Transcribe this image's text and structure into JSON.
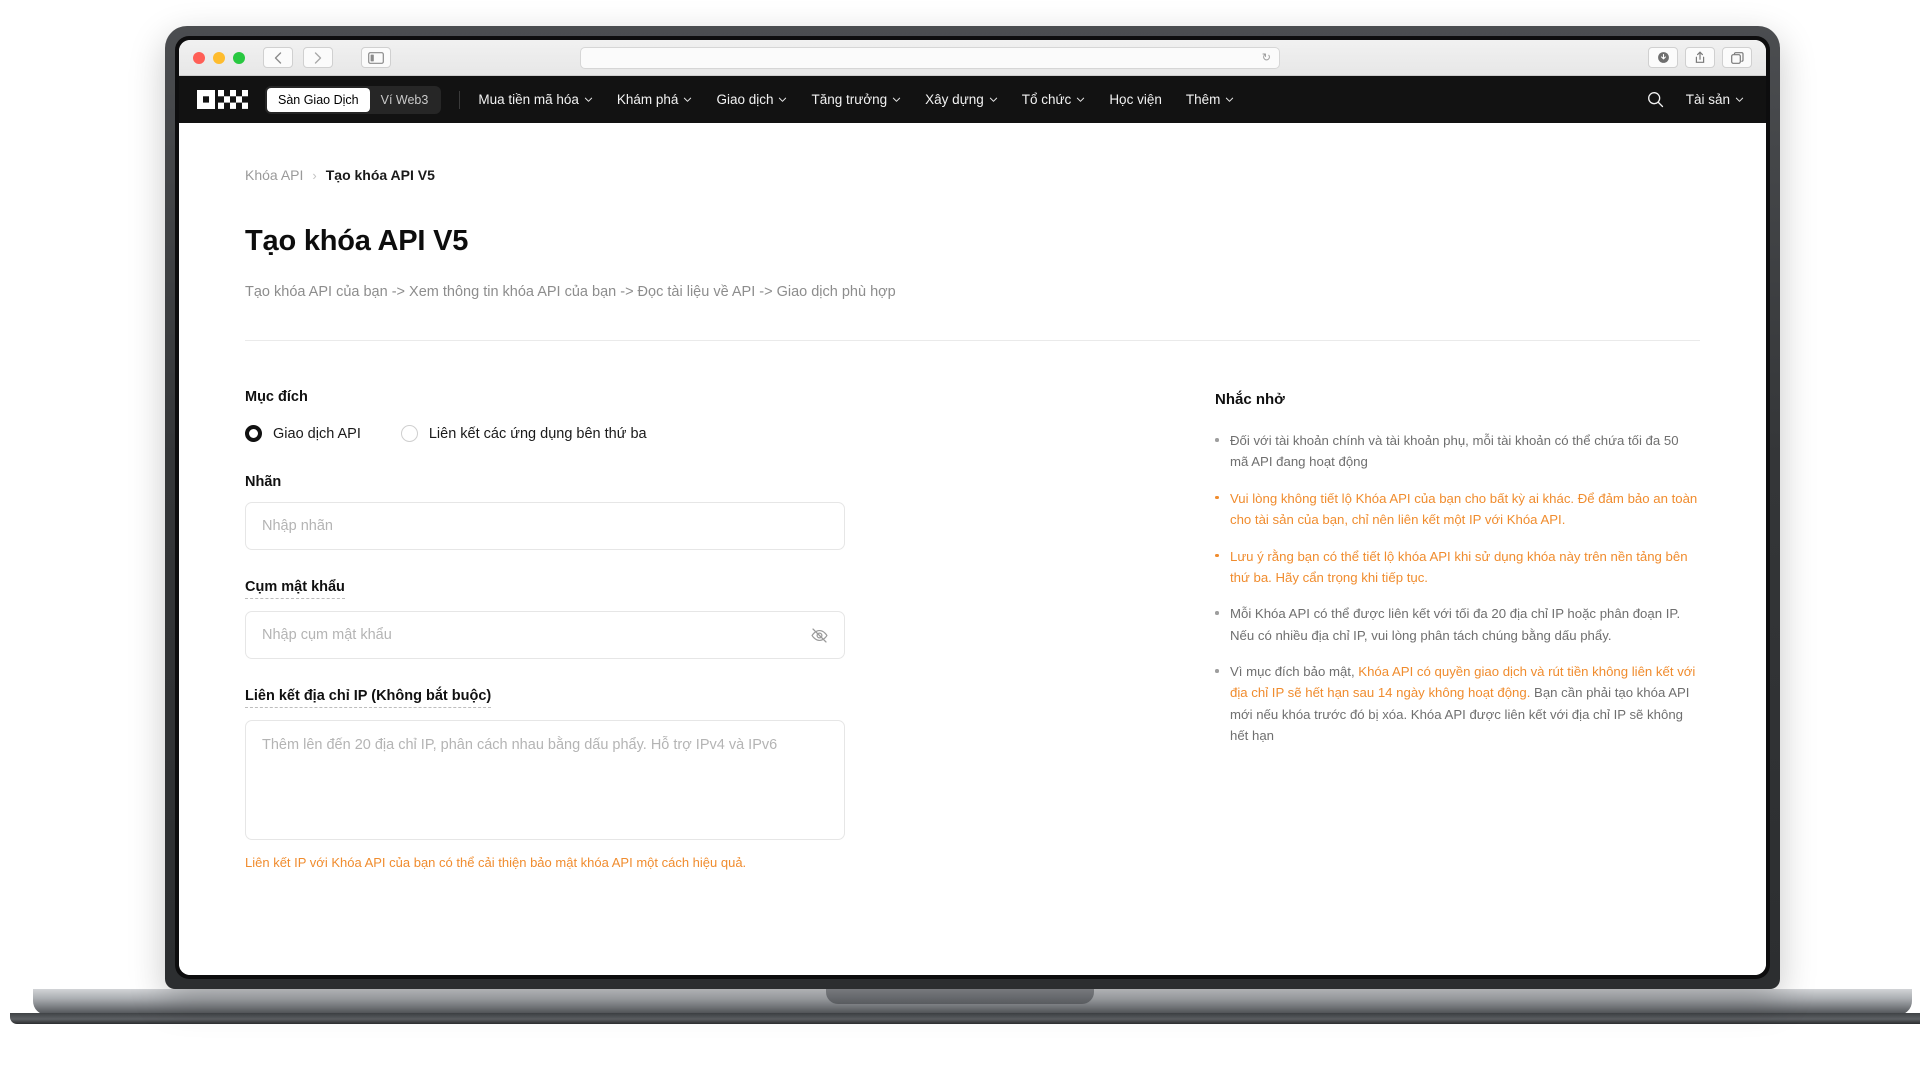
{
  "browser": {
    "back_label": "‹",
    "forward_label": "›",
    "sidebar_label": "sidebar-icon",
    "url_value": "",
    "url_placeholder": "",
    "reload_label": "↻",
    "downloads_label": "downloads-icon",
    "share_label": "share-icon",
    "tabs_label": "tabs-icon"
  },
  "nav": {
    "logo": "OKX",
    "segments": [
      {
        "label": "Sàn Giao Dịch",
        "active": true
      },
      {
        "label": "Ví Web3",
        "active": false
      }
    ],
    "links": [
      {
        "label": "Mua tiền mã hóa",
        "caret": true
      },
      {
        "label": "Khám phá",
        "caret": true
      },
      {
        "label": "Giao dịch",
        "caret": true
      },
      {
        "label": "Tăng trưởng",
        "caret": true
      },
      {
        "label": "Xây dựng",
        "caret": true
      },
      {
        "label": "Tổ chức",
        "caret": true
      },
      {
        "label": "Học viện",
        "caret": false
      },
      {
        "label": "Thêm",
        "caret": true
      }
    ],
    "search_icon": "search-icon",
    "assets_label": "Tài sản"
  },
  "breadcrumb": {
    "root": "Khóa API",
    "separator": "›",
    "current": "Tạo khóa API V5"
  },
  "page": {
    "title": "Tạo khóa API V5",
    "subtitle": "Tạo khóa API của bạn -> Xem thông tin khóa API của bạn -> Đọc tài liệu về API -> Giao dịch phù hợp"
  },
  "form": {
    "purpose_label": "Mục đích",
    "purpose_options": [
      {
        "label": "Giao dịch API",
        "selected": true
      },
      {
        "label": "Liên kết các ứng dụng bên thứ ba",
        "selected": false
      }
    ],
    "label_field": {
      "label": "Nhãn",
      "placeholder": "Nhập nhãn",
      "value": ""
    },
    "passphrase_field": {
      "label": "Cụm mật khẩu",
      "placeholder": "Nhập cụm mật khẩu",
      "value": "",
      "toggle_icon": "eye-off-icon"
    },
    "ip_field": {
      "label": "Liên kết địa chỉ IP (Không bắt buộc)",
      "placeholder": "Thêm lên đến 20 địa chỉ IP, phân cách nhau bằng dấu phẩy. Hỗ trợ IPv4 và IPv6",
      "value": "",
      "hint": "Liên kết IP với Khóa API của bạn có thể cải thiện bảo mật khóa API một cách hiệu quả."
    }
  },
  "reminders": {
    "title": "Nhắc nhở",
    "items": [
      {
        "style": "normal",
        "text": "Đối với tài khoản chính và tài khoản phụ, mỗi tài khoản có thể chứa tối đa 50 mã API đang hoạt động"
      },
      {
        "style": "warn",
        "text": "Vui lòng không tiết lộ Khóa API của bạn cho bất kỳ ai khác. Để đảm bảo an toàn cho tài sản của bạn, chỉ nên liên kết một IP với Khóa API."
      },
      {
        "style": "warn",
        "text": "Lưu ý rằng bạn có thể tiết lộ khóa API khi sử dụng khóa này trên nền tảng bên thứ ba. Hãy cẩn trọng khi tiếp tục."
      },
      {
        "style": "normal",
        "text": "Mỗi Khóa API có thể được liên kết với tối đa 20 địa chỉ IP hoặc phân đoạn IP. Nếu có nhiều địa chỉ IP, vui lòng phân tách chúng bằng dấu phẩy."
      },
      {
        "style": "mixed",
        "prefix": "Vì mục đích bảo mật, ",
        "highlight": "Khóa API có quyền giao dịch và rút tiền không liên kết với địa chỉ IP sẽ hết hạn sau 14 ngày không hoạt động.",
        "suffix": " Bạn cần phải tạo khóa API mới nếu khóa trước đó bị xóa. Khóa API được liên kết với địa chỉ IP sẽ không hết hạn"
      }
    ]
  },
  "colors": {
    "accent_orange": "#f08c2e",
    "nav_background": "#121212",
    "text_primary": "#101010",
    "text_muted": "#8d8d8d"
  }
}
